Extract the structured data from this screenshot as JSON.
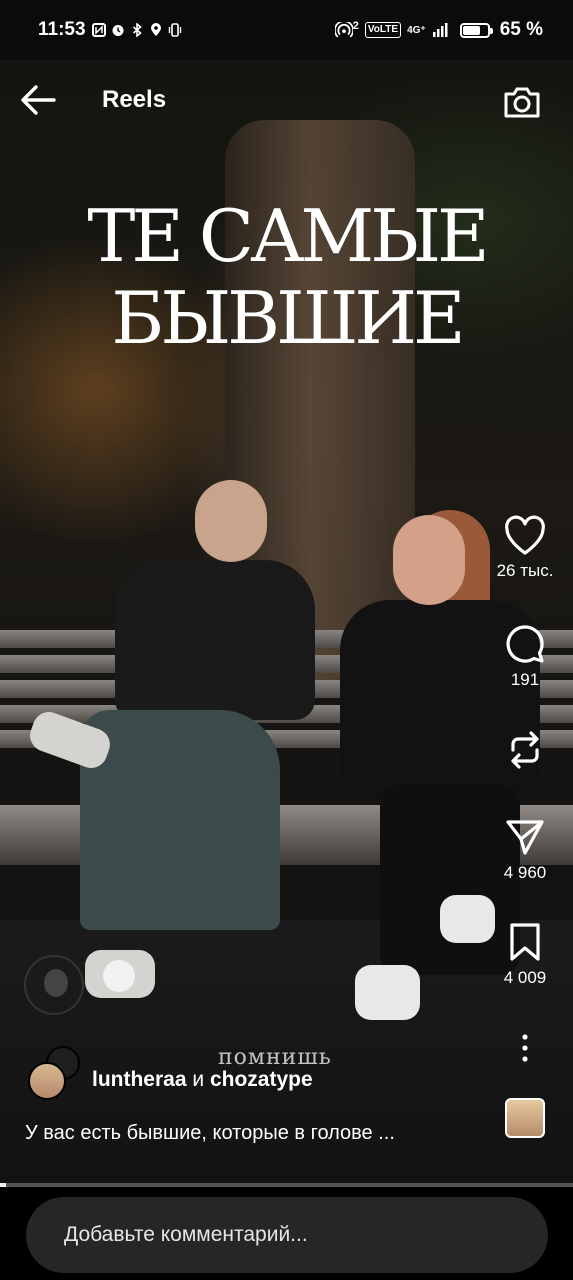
{
  "status_bar": {
    "time": "11:53",
    "signal_badge": "2",
    "volte": "VoLTE",
    "network": "4G⁺",
    "battery": "65 %",
    "battery_level": 0.65
  },
  "header": {
    "back_icon": "arrow-left-icon",
    "title": "Reels",
    "camera_icon": "camera-icon"
  },
  "video": {
    "overlay_line1": "ТЕ САМЫЕ",
    "overlay_line2": "БЫВШИЕ",
    "caption_word": "помнишь"
  },
  "actions": {
    "like_count": "26 тыс.",
    "comment_count": "191",
    "share_count": "4 960",
    "save_count": "4 009"
  },
  "post": {
    "author1": "luntheraa",
    "conjunction": "и",
    "author2": "chozatype",
    "description": "У вас есть бывшие, которые в голове ...",
    "progress": 0.01
  },
  "comment": {
    "placeholder": "Добавьте комментарий..."
  }
}
